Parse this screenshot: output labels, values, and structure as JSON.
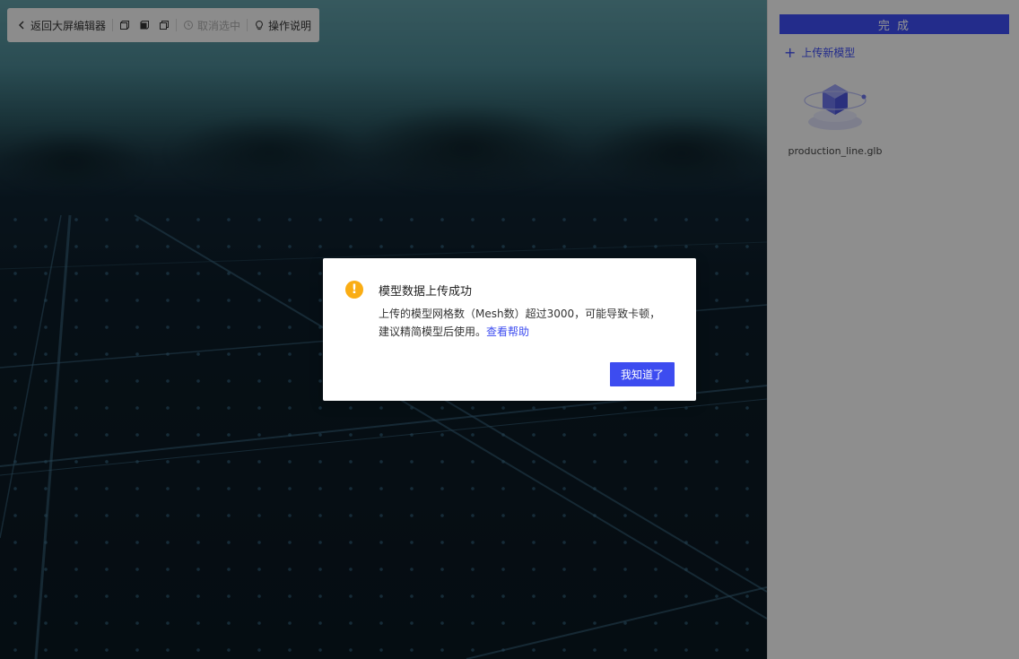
{
  "toolbar": {
    "back_label": "返回大屏编辑器",
    "cancel_select_label": "取消选中",
    "help_label": "操作说明"
  },
  "panel": {
    "done_label": "完 成",
    "upload_label": "上传新模型",
    "models": [
      {
        "name": "production_line.glb",
        "icon": "cube-model-icon"
      }
    ]
  },
  "modal": {
    "icon": "warning-icon",
    "title": "模型数据上传成功",
    "content": "上传的模型网格数（Mesh数）超过3000，可能导致卡顿，建议精简模型后使用。",
    "link_label": "查看帮助",
    "ok_label": "我知道了"
  },
  "colors": {
    "primary": "#3d4cf0",
    "warning": "#faad14",
    "scene_sky": "#5f9aa3",
    "scene_ground": "#0a1720"
  }
}
